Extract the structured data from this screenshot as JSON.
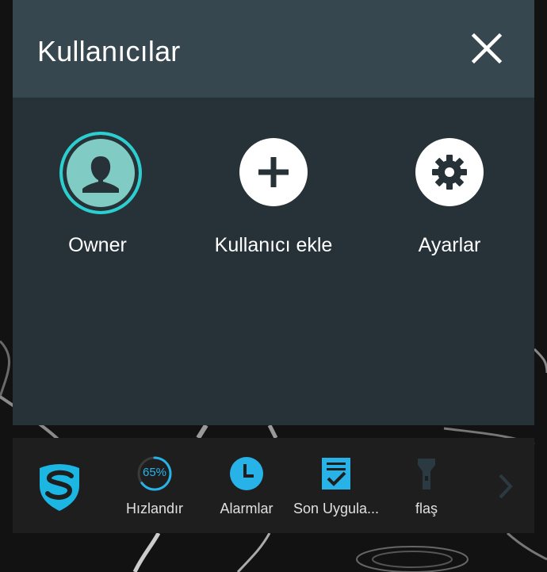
{
  "panel": {
    "title": "Kullanıcılar",
    "close_icon": "close-icon",
    "tiles": [
      {
        "label": "Owner",
        "icon": "user-avatar-icon"
      },
      {
        "label": "Kullanıcı ekle",
        "icon": "plus-icon"
      },
      {
        "label": "Ayarlar",
        "icon": "gear-icon"
      }
    ]
  },
  "dock": {
    "items": [
      {
        "label": "",
        "icon": "security-shield-logo-icon"
      },
      {
        "label": "Hızlandır",
        "icon": "boost-gauge-icon",
        "percent_text": "65%",
        "progress": 0.65
      },
      {
        "label": "Alarmlar",
        "icon": "clock-icon"
      },
      {
        "label": "Son Uygula...",
        "icon": "checklist-icon"
      },
      {
        "label": "flaş",
        "icon": "flashlight-icon"
      }
    ],
    "next_icon": "chevron-right-icon"
  },
  "colors": {
    "header_bg": "#37474f",
    "panel_bg": "#263238",
    "accent_teal": "#2ccfd0",
    "accent_blue": "#28b3e8",
    "dock_bg": "#1e1e1e"
  }
}
